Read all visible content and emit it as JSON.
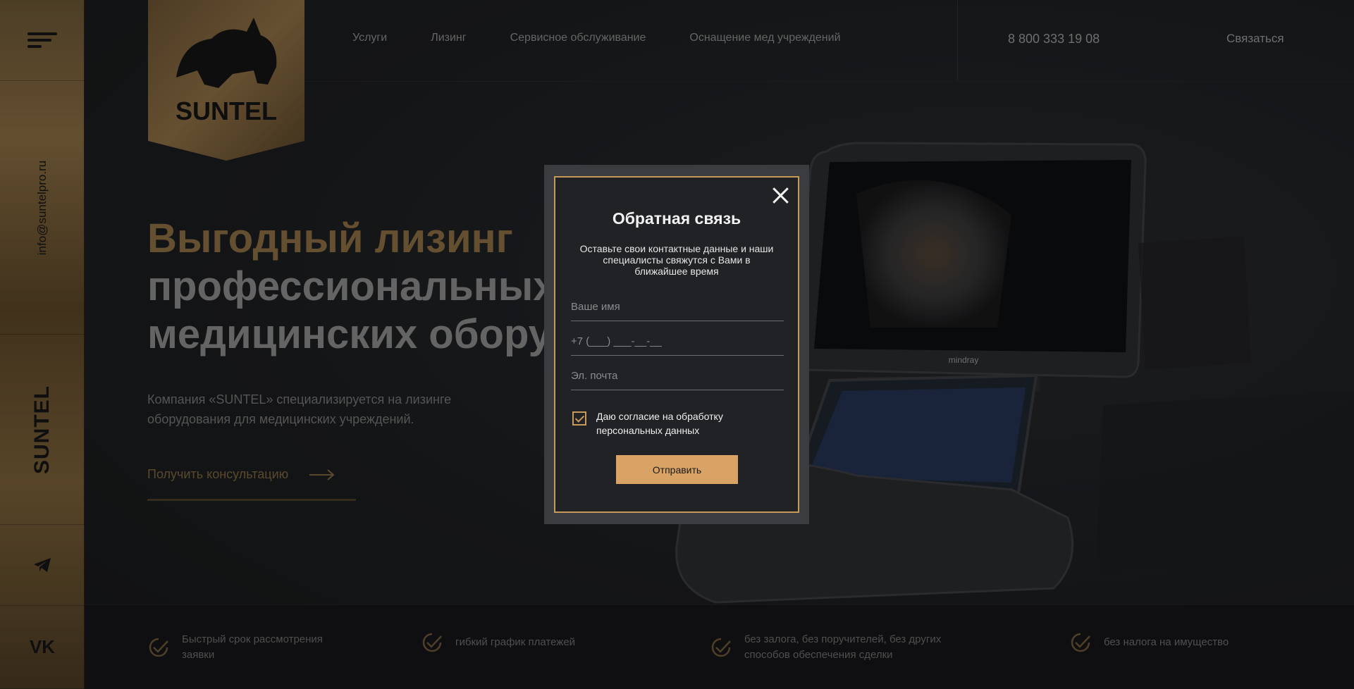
{
  "sidebar": {
    "email": "info@suntelpro.ru",
    "brand": "SUNTEL",
    "vk_label": "VK"
  },
  "logo": {
    "text": "SUNTEL"
  },
  "nav": {
    "items": [
      "Услуги",
      "Лизинг",
      "Сервисное обслуживание",
      "Оснащение мед учреждений"
    ],
    "phone": "8 800 333 19 08",
    "contact": "Связаться"
  },
  "hero": {
    "title_accent": "Выгодный лизинг",
    "title_line2": "профессиональных",
    "title_line3": "медицинских обору",
    "description": "Компания «SUNTEL» специализируется на лизинге оборудования для медицинских учреждений.",
    "cta": "Получить консультацию"
  },
  "device": {
    "brand": "mindray"
  },
  "benefits": [
    "Быстрый срок рассмотрения заявки",
    "гибкий график платежей",
    "без залога, без поручителей, без других способов обеспечения сделки",
    "без налога на имущество"
  ],
  "modal": {
    "title": "Обратная связь",
    "subtitle": "Оставьте свои контактные данные и наши специалисты свяжутся с Вами в ближайшее время",
    "name_placeholder": "Ваше имя",
    "phone_placeholder": "+7 (___) ___-__-__",
    "email_placeholder": "Эл. почта",
    "consent": "Даю согласие на обработку персональных данных",
    "consent_checked": true,
    "submit": "Отправить"
  },
  "colors": {
    "accent": "#c79a5c",
    "button": "#d9a365",
    "background": "#1b1d1f"
  }
}
